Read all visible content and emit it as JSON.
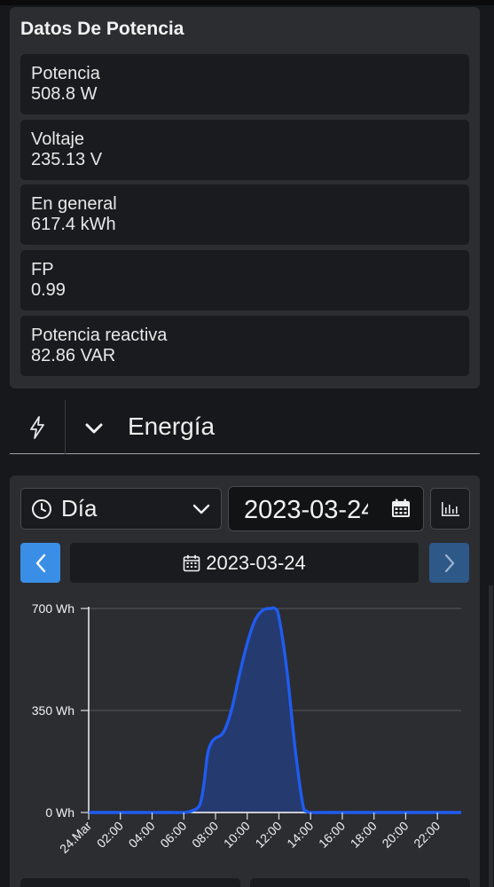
{
  "power": {
    "title": "Datos De Potencia",
    "metrics": [
      {
        "label": "Potencia",
        "value": "508.8 W"
      },
      {
        "label": "Voltaje",
        "value": "235.13 V"
      },
      {
        "label": "En general",
        "value": "617.4 kWh"
      },
      {
        "label": "FP",
        "value": "0.99"
      },
      {
        "label": "Potencia reactiva",
        "value": "82.86 VAR"
      }
    ]
  },
  "energy": {
    "title": "Energía",
    "icons": {
      "section": "bolt-icon",
      "toggle": "chevron-down-icon"
    },
    "period": {
      "label": "Día",
      "icon": "clock-icon",
      "dropdown_icon": "chevron-down-icon"
    },
    "date_input": {
      "value": "2023-03-24",
      "icon": "calendar-icon"
    },
    "chart_toggle_icon": "bar-chart-icon",
    "nav": {
      "prev_icon": "chevron-left-icon",
      "next_icon": "chevron-right-icon",
      "current_date": "2023-03-24",
      "date_icon": "calendar-icon"
    }
  },
  "colors": {
    "background": "#17181b",
    "card": "#2c2d31",
    "field": "#1a1b1e",
    "accent": "#3a8ee6",
    "accent_muted": "#2d5888",
    "series_line": "#1f5cf0",
    "series_fill": "#253a6e"
  },
  "chart_data": {
    "type": "area",
    "x_unit": "hour",
    "y_unit": "Wh",
    "x_tick_labels": [
      "24.Mar",
      "02:00",
      "04:00",
      "06:00",
      "08:00",
      "10:00",
      "12:00",
      "14:00",
      "16:00",
      "18:00",
      "20:00",
      "22:00"
    ],
    "y_tick_labels": [
      "0 Wh",
      "350 Wh",
      "700 Wh"
    ],
    "y_ticks": [
      0,
      350,
      700
    ],
    "xlim": [
      0,
      23.5
    ],
    "ylim": [
      0,
      700
    ],
    "grid": true,
    "legend": "none",
    "x": [
      0,
      1,
      2,
      3,
      4,
      5,
      6,
      6.5,
      7,
      7.25,
      7.5,
      7.75,
      8,
      8.5,
      9,
      9.5,
      10,
      10.5,
      11,
      11.5,
      11.75,
      12,
      12.5,
      13,
      13.5,
      13.75,
      14,
      15,
      16,
      17,
      18,
      19,
      20,
      21,
      22,
      23,
      23.5
    ],
    "y": [
      0,
      0,
      0,
      0,
      0,
      0,
      0,
      5,
      25,
      90,
      200,
      240,
      255,
      275,
      350,
      470,
      580,
      660,
      695,
      700,
      700,
      670,
      490,
      230,
      30,
      5,
      0,
      0,
      0,
      0,
      0,
      0,
      0,
      0,
      0,
      0,
      0
    ]
  }
}
